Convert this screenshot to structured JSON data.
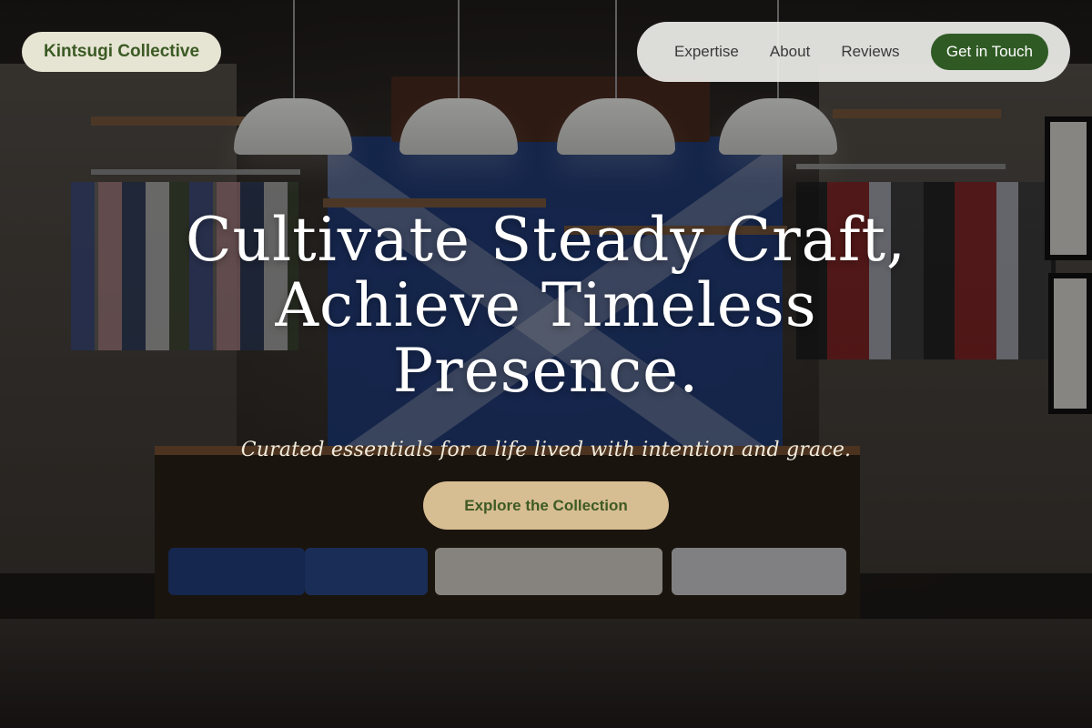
{
  "brand": {
    "name": "Kintsugi Collective"
  },
  "nav": {
    "items": [
      {
        "label": "Expertise"
      },
      {
        "label": "About"
      },
      {
        "label": "Reviews"
      }
    ],
    "cta_label": "Get in Touch"
  },
  "hero": {
    "headline_lines": [
      "Cultivate Steady Craft,",
      "Achieve Timeless",
      "Presence."
    ],
    "subtitle": "Curated essentials for a life lived with intention and grace.",
    "button_label": "Explore the Collection"
  },
  "colors": {
    "brand_green": "#2f5a24",
    "brand_pill_bg": "#e6e4d2",
    "button_tan": "#d7bd92"
  }
}
